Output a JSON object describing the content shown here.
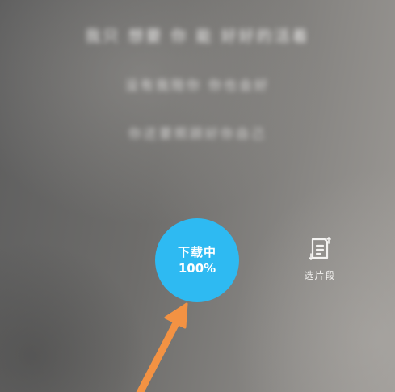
{
  "lyrics": {
    "line1": "我只 想要 你 能 好好的活着",
    "line2": "没有我陪你 你也会好",
    "line3": "你还要照顾好你自己"
  },
  "download": {
    "status_label": "下载中",
    "progress_text": "100%",
    "progress": 1.0,
    "color": "#2ebaf2"
  },
  "clip": {
    "label": "选片段",
    "icon": "clip-segment-icon"
  },
  "annotation": {
    "arrow_color": "#f39243"
  }
}
